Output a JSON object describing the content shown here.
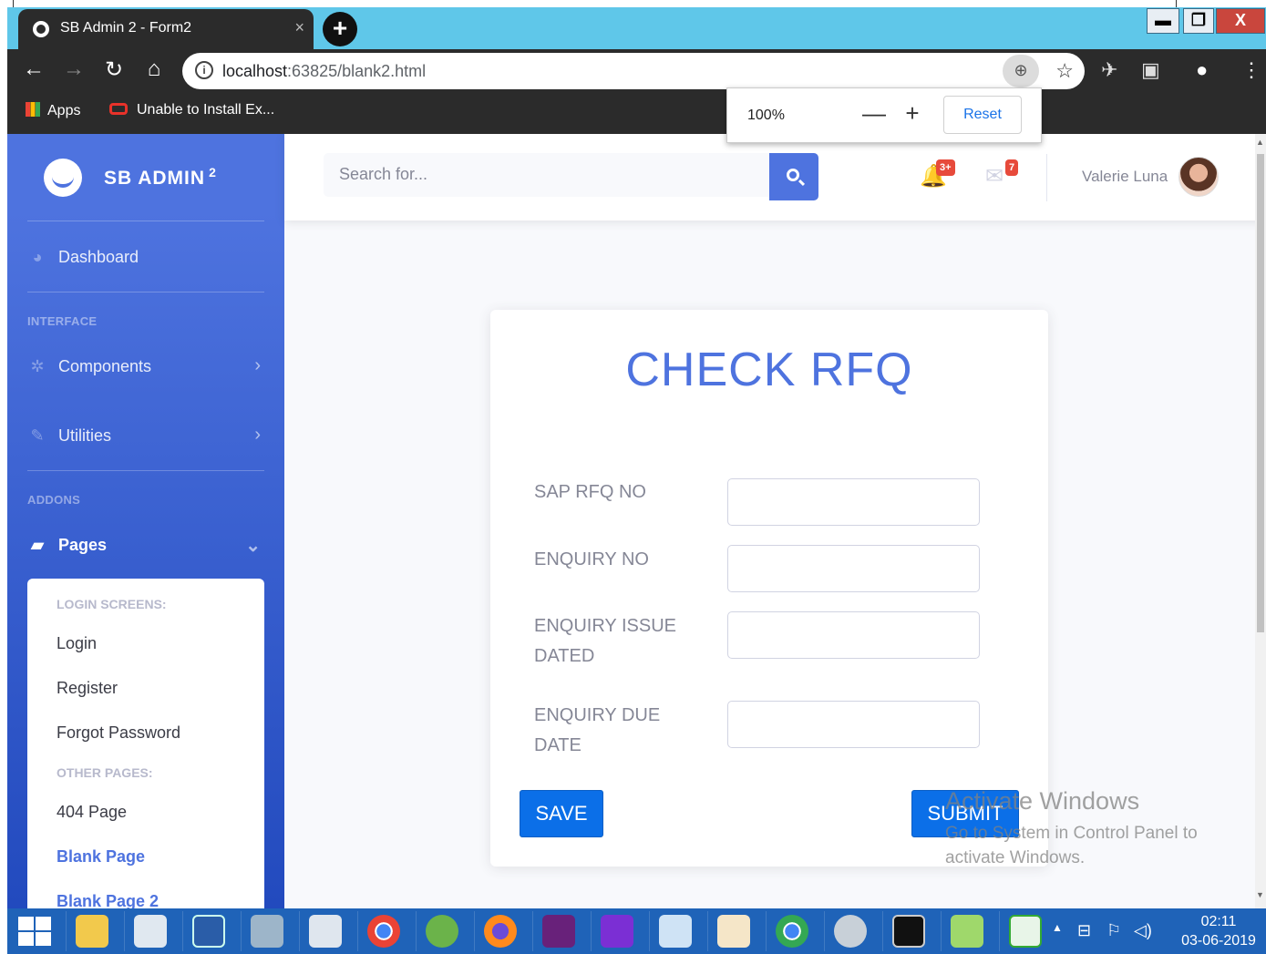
{
  "browser": {
    "tab_title": "SB Admin 2 - Form2",
    "tab_close": "×",
    "new_tab": "+",
    "url_host": "localhost",
    "url_path": ":63825/blank2.html",
    "bookmarks": [
      "Apps",
      "Unable to Install Ex..."
    ],
    "zoom": {
      "level": "100%",
      "minus": "—",
      "plus": "+",
      "reset": "Reset"
    },
    "window_controls": {
      "minimize": "▬",
      "restore": "❐",
      "close": "X"
    }
  },
  "brand": {
    "name": "SB ADMIN",
    "version": "2"
  },
  "sidebar": {
    "dashboard": "Dashboard",
    "heading_interface": "INTERFACE",
    "components": "Components",
    "utilities": "Utilities",
    "heading_addons": "ADDONS",
    "pages": "Pages",
    "collapse": {
      "login_heading": "LOGIN SCREENS:",
      "login": "Login",
      "register": "Register",
      "forgot": "Forgot Password",
      "other_heading": "OTHER PAGES:",
      "page404": "404 Page",
      "blank": "Blank Page",
      "blank2": "Blank Page 2"
    }
  },
  "topbar": {
    "search_placeholder": "Search for...",
    "alerts_badge": "3+",
    "messages_badge": "7",
    "user_name": "Valerie Luna"
  },
  "form": {
    "title": "CHECK RFQ",
    "fields": [
      {
        "label": "SAP RFQ NO",
        "value": ""
      },
      {
        "label": "ENQUIRY NO",
        "value": ""
      },
      {
        "label": "ENQUIRY ISSUE DATED",
        "value": ""
      },
      {
        "label": "ENQUIRY DUE DATE",
        "value": ""
      }
    ],
    "save_label": "SAVE",
    "submit_label": "SUBMIT"
  },
  "watermark": {
    "line1": "Activate Windows",
    "line2": "Go to System in Control Panel to",
    "line3": "activate Windows."
  },
  "taskbar": {
    "time": "02:11",
    "date": "03-06-2019"
  },
  "colors": {
    "primary": "#4e73df",
    "button": "#0b6fe8",
    "titlebar": "#5fc7e9"
  }
}
